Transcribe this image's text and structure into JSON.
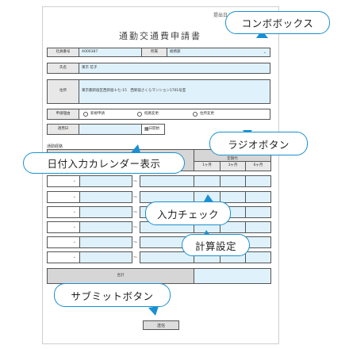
{
  "header": {
    "date_label": "提出日",
    "title": "通勤交通費申請書"
  },
  "form": {
    "employee_no_label": "社員番号",
    "employee_no_value": "A000387",
    "department_label": "所属",
    "department_value": "総務部",
    "name_label": "氏名",
    "name_value": "東京 花子",
    "address_label": "住所",
    "address_value": "東京都新宿区西新宿十七-15　西新宿さくらマンション1701号室",
    "reason_label": "申請理由",
    "reason_options": [
      "新規申請",
      "経路変更",
      "住所変更"
    ],
    "apply_date_label": "適用日",
    "calendar_text": "日開始",
    "route_section_label": "通勤経路",
    "period_header": "定期代",
    "periods": [
      "1ヶ月",
      "3ヶ月",
      "6ヶ月"
    ],
    "total_label": "合計",
    "submit_label": "送信"
  },
  "callouts": {
    "combobox": "コンボボックス",
    "radio": "ラジオボタン",
    "calendar": "日付入力カレンダー表示",
    "input_check": "入力チェック",
    "calc": "計算設定",
    "submit": "サブミットボタン"
  },
  "colors": {
    "accent": "#1a90d0",
    "field": "#dff1fb",
    "label_bg": "#e8e8e8"
  }
}
